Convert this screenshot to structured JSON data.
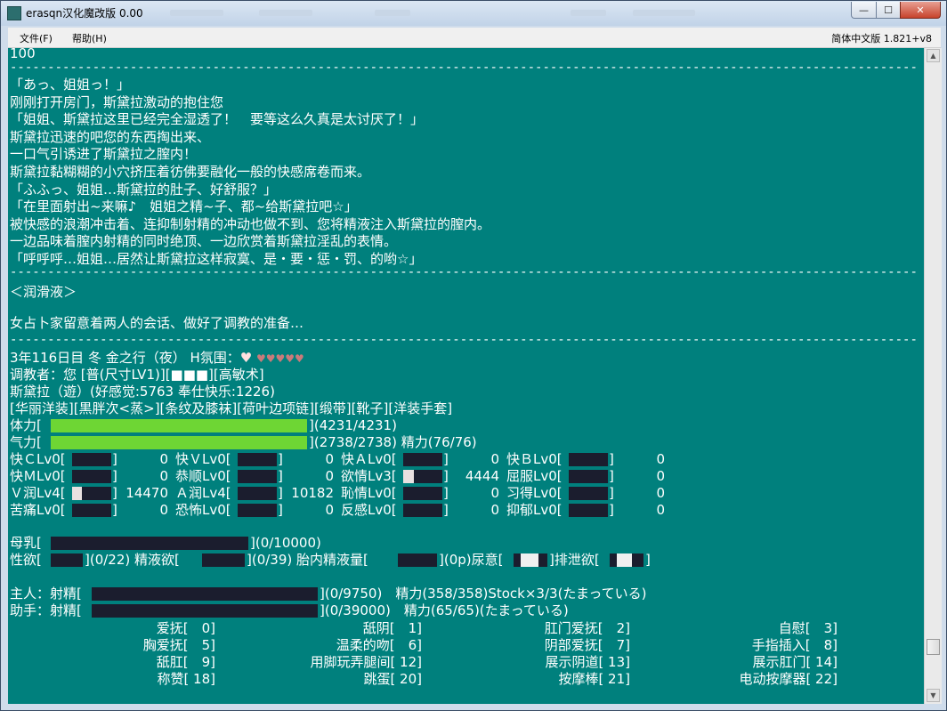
{
  "window": {
    "title": "erasqn汉化魔改版 0.00",
    "min_label": "—",
    "max_label": "☐",
    "close_label": "✕"
  },
  "menu": {
    "file": "文件(F)",
    "help": "帮助(H)",
    "version": "简体中文版 1.821+v8"
  },
  "console": {
    "top_number": "100",
    "separator": "--------------------------------------------------------------------------------------------------------------------------------------------",
    "story": [
      "「あっ、姐姐っ！」",
      "刚刚打开房门，斯黛拉激动的抱住您",
      "「姐姐、斯黛拉这里已经完全湿透了！　要等这么久真是太讨厌了！」",
      "斯黛拉迅速的吧您的东西掏出来、",
      "一口气引诱进了斯黛拉之膣内！",
      "斯黛拉黏糊糊的小穴挤压着彷佛要融化一般的快感席卷而来。",
      "「ふふっ、姐姐…斯黛拉的肚子、好舒服？」",
      "「在里面射出~来嘛♪　姐姐之精~子、都~给斯黛拉吧☆」",
      "被快感的浪潮冲击着、连抑制射精的冲动也做不到、您将精液注入斯黛拉的膣内。",
      "一边品味着膣内射精的同时绝顶、一边欣赏着斯黛拉淫乱的表情。",
      "「呼呼呼…姐姐…居然让斯黛拉这样寂寞、是・要・惩・罚、的哟☆」"
    ],
    "section_title": "＜润滑液＞",
    "prep_text": "女占卜家留意着两人的会话、做好了调教的准备…",
    "status_header": "3年116日目 冬 金之行（夜） H氛围：",
    "heart_on": "♥",
    "heart_off": "♥♥♥♥♥",
    "trainer": "调教者：您 [普(尺寸LV1)][■■■][高敏术]",
    "target": "斯黛拉（遊）(好感觉:5763 奉仕快乐:1226)",
    "equipment": "[华丽洋装][黒胖次<蒸>][条纹及膝袜][荷叶边项链][缎带][靴子][洋装手套]",
    "hp_label": "体力[",
    "hp_value": "](4231/4231)",
    "hp_fill": 1.0,
    "sp_label": "气力[",
    "sp_value": "](2738/2738) 精力(76/76)",
    "sp_fill": 1.0,
    "stats": [
      [
        "快ＣLv0[",
        "0",
        "快ＶLv0[",
        "0",
        "快ＡLv0[",
        "0",
        "快ＢLv0[",
        "0"
      ],
      [
        "快ＭLv0[",
        "0",
        "恭顺Lv0[",
        "0",
        "欲情Lv3[",
        "4444",
        "屈服Lv0[",
        "0"
      ],
      [
        "Ｖ润Lv4[",
        "14470",
        "Ａ润Lv4[",
        "10182",
        "恥情Lv0[",
        "0",
        "习得Lv0[",
        "0"
      ],
      [
        "苦痛Lv0[",
        "0",
        "恐怖Lv0[",
        "0",
        "反感Lv0[",
        "0",
        "抑郁Lv0[",
        "0"
      ]
    ],
    "stat_fill": [
      [
        0,
        0,
        0,
        0
      ],
      [
        0,
        0,
        0.27,
        0
      ],
      [
        0.25,
        0,
        0,
        0
      ],
      [
        0,
        0,
        0,
        0
      ]
    ],
    "milk_label": "母乳[",
    "milk_value": "](0/10000)",
    "lust_line": [
      "性欲[",
      "](0/22) 精液欲[",
      "](0/39) 胎内精液量[",
      "](0p)尿意[",
      "]排泄欲[",
      "]"
    ],
    "master_label": "主人：射精[",
    "master_value": "](0/9750)　精力(358/358)Stock×3/3(たまっている)",
    "assist_label": "助手：射精[",
    "assist_value": "](0/39000)　精力(65/65)(たまっている)",
    "commands": [
      [
        "爱抚[　0]",
        "舐阴[　1]",
        "肛门爱抚[　2]",
        "自慰[　3]"
      ],
      [
        "胸爱抚[　5]",
        "温柔的吻[　6]",
        "阴部爱抚[　7]",
        "手指插入[　8]"
      ],
      [
        "舐肛[　9]",
        "用脚玩弄腿间[ 12]",
        "展示阴道[ 13]",
        "展示肛门[ 14]"
      ],
      [
        "称赞[ 18]",
        "跳蛋[ 20]",
        "按摩棒[ 21]",
        "电动按摩器[ 22]"
      ]
    ]
  },
  "colors": {
    "console_bg": "#00807d",
    "bar_fill": "#6ed634",
    "bar_empty": "#1b1d2e"
  }
}
